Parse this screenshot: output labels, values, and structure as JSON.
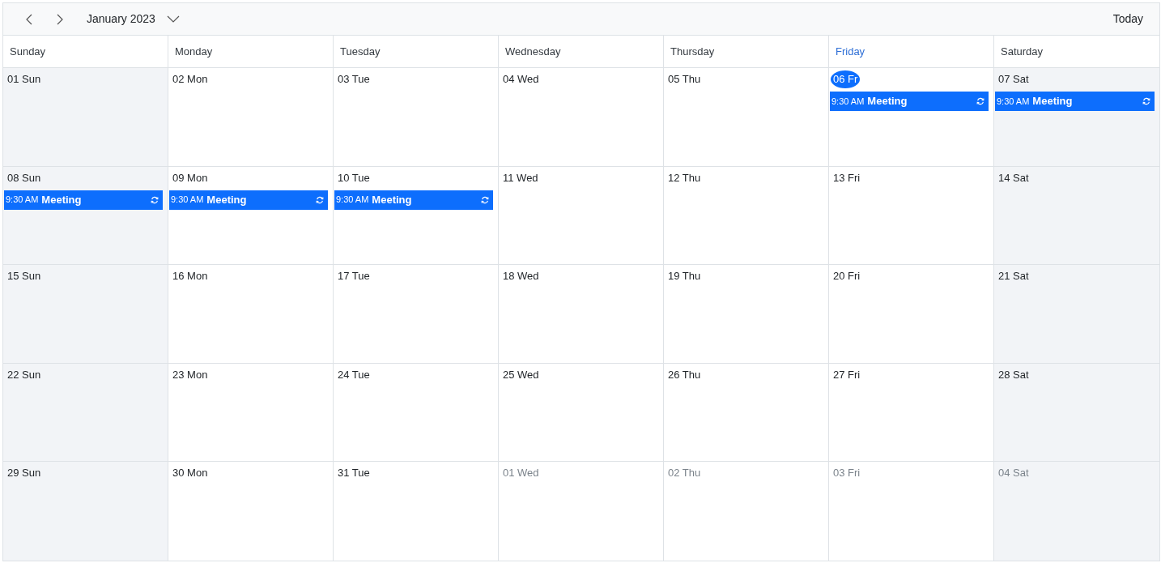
{
  "toolbar": {
    "month": "January 2023",
    "today_button": "Today"
  },
  "weekdays": [
    {
      "label": "Sunday",
      "today": false
    },
    {
      "label": "Monday",
      "today": false
    },
    {
      "label": "Tuesday",
      "today": false
    },
    {
      "label": "Wednesday",
      "today": false
    },
    {
      "label": "Thursday",
      "today": false
    },
    {
      "label": "Friday",
      "today": true
    },
    {
      "label": "Saturday",
      "today": false
    }
  ],
  "weeks": [
    {
      "days": [
        {
          "date": "01 Sun",
          "weekend": true,
          "other_month": false,
          "today": false
        },
        {
          "date": "02 Mon",
          "weekend": false,
          "other_month": false,
          "today": false
        },
        {
          "date": "03 Tue",
          "weekend": false,
          "other_month": false,
          "today": false
        },
        {
          "date": "04 Wed",
          "weekend": false,
          "other_month": false,
          "today": false
        },
        {
          "date": "05 Thu",
          "weekend": false,
          "other_month": false,
          "today": false
        },
        {
          "date": "06 Fr",
          "weekend": false,
          "other_month": false,
          "today": true,
          "events": [
            {
              "time": "9:30 AM",
              "title": "Meeting",
              "recurring": true
            }
          ]
        },
        {
          "date": "07 Sat",
          "weekend": true,
          "other_month": false,
          "today": false,
          "events": [
            {
              "time": "9:30 AM",
              "title": "Meeting",
              "recurring": true
            }
          ]
        }
      ]
    },
    {
      "days": [
        {
          "date": "08 Sun",
          "weekend": true,
          "other_month": false,
          "today": false,
          "events": [
            {
              "time": "9:30 AM",
              "title": "Meeting",
              "recurring": true
            }
          ]
        },
        {
          "date": "09 Mon",
          "weekend": false,
          "other_month": false,
          "today": false,
          "events": [
            {
              "time": "9:30 AM",
              "title": "Meeting",
              "recurring": true
            }
          ]
        },
        {
          "date": "10 Tue",
          "weekend": false,
          "other_month": false,
          "today": false,
          "events": [
            {
              "time": "9:30 AM",
              "title": "Meeting",
              "recurring": true
            }
          ]
        },
        {
          "date": "11 Wed",
          "weekend": false,
          "other_month": false,
          "today": false
        },
        {
          "date": "12 Thu",
          "weekend": false,
          "other_month": false,
          "today": false
        },
        {
          "date": "13 Fri",
          "weekend": false,
          "other_month": false,
          "today": false
        },
        {
          "date": "14 Sat",
          "weekend": true,
          "other_month": false,
          "today": false
        }
      ]
    },
    {
      "days": [
        {
          "date": "15 Sun",
          "weekend": true,
          "other_month": false,
          "today": false
        },
        {
          "date": "16 Mon",
          "weekend": false,
          "other_month": false,
          "today": false
        },
        {
          "date": "17 Tue",
          "weekend": false,
          "other_month": false,
          "today": false
        },
        {
          "date": "18 Wed",
          "weekend": false,
          "other_month": false,
          "today": false
        },
        {
          "date": "19 Thu",
          "weekend": false,
          "other_month": false,
          "today": false
        },
        {
          "date": "20 Fri",
          "weekend": false,
          "other_month": false,
          "today": false
        },
        {
          "date": "21 Sat",
          "weekend": true,
          "other_month": false,
          "today": false
        }
      ]
    },
    {
      "days": [
        {
          "date": "22 Sun",
          "weekend": true,
          "other_month": false,
          "today": false
        },
        {
          "date": "23 Mon",
          "weekend": false,
          "other_month": false,
          "today": false
        },
        {
          "date": "24 Tue",
          "weekend": false,
          "other_month": false,
          "today": false
        },
        {
          "date": "25 Wed",
          "weekend": false,
          "other_month": false,
          "today": false
        },
        {
          "date": "26 Thu",
          "weekend": false,
          "other_month": false,
          "today": false
        },
        {
          "date": "27 Fri",
          "weekend": false,
          "other_month": false,
          "today": false
        },
        {
          "date": "28 Sat",
          "weekend": true,
          "other_month": false,
          "today": false
        }
      ]
    },
    {
      "days": [
        {
          "date": "29 Sun",
          "weekend": true,
          "other_month": false,
          "today": false
        },
        {
          "date": "30 Mon",
          "weekend": false,
          "other_month": false,
          "today": false
        },
        {
          "date": "31 Tue",
          "weekend": false,
          "other_month": false,
          "today": false
        },
        {
          "date": "01 Wed",
          "weekend": false,
          "other_month": true,
          "today": false
        },
        {
          "date": "02 Thu",
          "weekend": false,
          "other_month": true,
          "today": false
        },
        {
          "date": "03 Fri",
          "weekend": false,
          "other_month": true,
          "today": false
        },
        {
          "date": "04 Sat",
          "weekend": true,
          "other_month": true,
          "today": false
        }
      ]
    }
  ]
}
